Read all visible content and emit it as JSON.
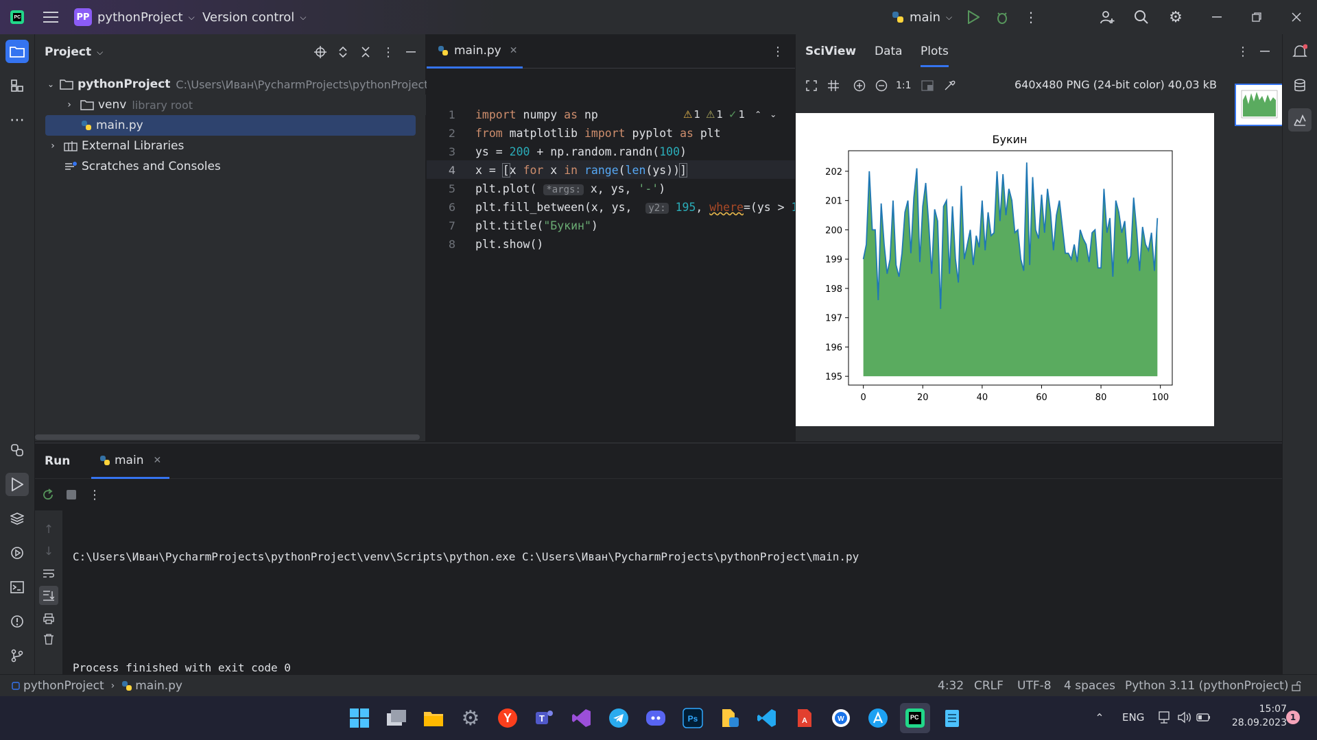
{
  "titlebar": {
    "project_badge": "PP",
    "project_name": "pythonProject",
    "vcs_label": "Version control",
    "run_config": "main"
  },
  "project_panel": {
    "title": "Project",
    "root_name": "pythonProject",
    "root_path": "C:\\Users\\Иван\\PycharmProjects\\pythonProject",
    "venv_name": "venv",
    "venv_note": "library root",
    "file_main": "main.py",
    "external_libraries": "External Libraries",
    "scratches": "Scratches and Consoles"
  },
  "editor": {
    "tab_name": "main.py",
    "inspections": {
      "warn1": "1",
      "warn2": "1",
      "ok": "1"
    },
    "line_numbers": [
      "1",
      "2",
      "3",
      "4",
      "5",
      "6",
      "7",
      "8"
    ]
  },
  "sciview": {
    "title": "SciView",
    "tab_data": "Data",
    "tab_plots": "Plots",
    "zoom_label": "1:1",
    "image_info": "640x480 PNG (24-bit color) 40,03 kB"
  },
  "chart_data": {
    "type": "area",
    "title": "Букин",
    "xlabel": "",
    "ylabel": "",
    "xlim": [
      -5,
      104
    ],
    "ylim": [
      194.7,
      202.7
    ],
    "fill_baseline": 195,
    "xticks": [
      "0",
      "20",
      "40",
      "60",
      "80",
      "100"
    ],
    "yticks": [
      "195",
      "196",
      "197",
      "198",
      "199",
      "200",
      "201",
      "202"
    ],
    "line_color": "#1f77b4",
    "fill_color": "#5aab5f",
    "values": [
      199.0,
      199.5,
      202.0,
      200.0,
      200.0,
      197.6,
      200.9,
      199.5,
      198.5,
      199.0,
      201.0,
      198.8,
      198.4,
      199.2,
      200.6,
      201.0,
      199.2,
      201.1,
      202.1,
      198.9,
      200.8,
      201.6,
      200.2,
      198.5,
      200.7,
      200.3,
      197.3,
      200.8,
      201.0,
      198.5,
      200.8,
      199.0,
      198.2,
      201.5,
      199.0,
      199.5,
      200.0,
      198.8,
      199.8,
      199.4,
      201.0,
      199.3,
      200.6,
      199.8,
      199.9,
      202.0,
      200.3,
      201.9,
      200.5,
      201.4,
      201.0,
      199.9,
      200.0,
      199.0,
      198.6,
      202.3,
      198.8,
      201.8,
      200.0,
      199.7,
      201.2,
      199.9,
      201.4,
      200.6,
      199.3,
      200.5,
      201.0,
      200.1,
      199.2,
      199.2,
      199.0,
      199.5,
      198.9,
      200.0,
      199.7,
      199.5,
      198.9,
      199.9,
      200.0,
      198.7,
      198.7,
      201.4,
      199.9,
      200.4,
      198.4,
      201.0,
      200.6,
      199.9,
      200.3,
      198.9,
      199.1,
      201.1,
      200.0,
      198.6,
      200.1,
      199.5,
      199.3,
      199.9,
      198.6,
      200.4
    ]
  },
  "run_panel": {
    "tab_run": "Run",
    "tab_main": "main",
    "cmd_line": "C:\\Users\\Иван\\PycharmProjects\\pythonProject\\venv\\Scripts\\python.exe C:\\Users\\Иван\\PycharmProjects\\pythonProject\\main.py",
    "exit_line": "Process finished with exit code 0"
  },
  "statusbar": {
    "breadcrumb_project": "pythonProject",
    "breadcrumb_file": "main.py",
    "position": "4:32",
    "line_sep": "CRLF",
    "encoding": "UTF-8",
    "indent": "4 spaces",
    "interpreter": "Python 3.11 (pythonProject)"
  },
  "taskbar": {
    "lang": "ENG",
    "time": "15:07",
    "date": "28.09.2023",
    "notif_count": "1"
  },
  "colors": {
    "accent": "#3574f0",
    "selection": "#2e436e",
    "plot_fill": "#5aab5f",
    "plot_line": "#1f77b4"
  }
}
